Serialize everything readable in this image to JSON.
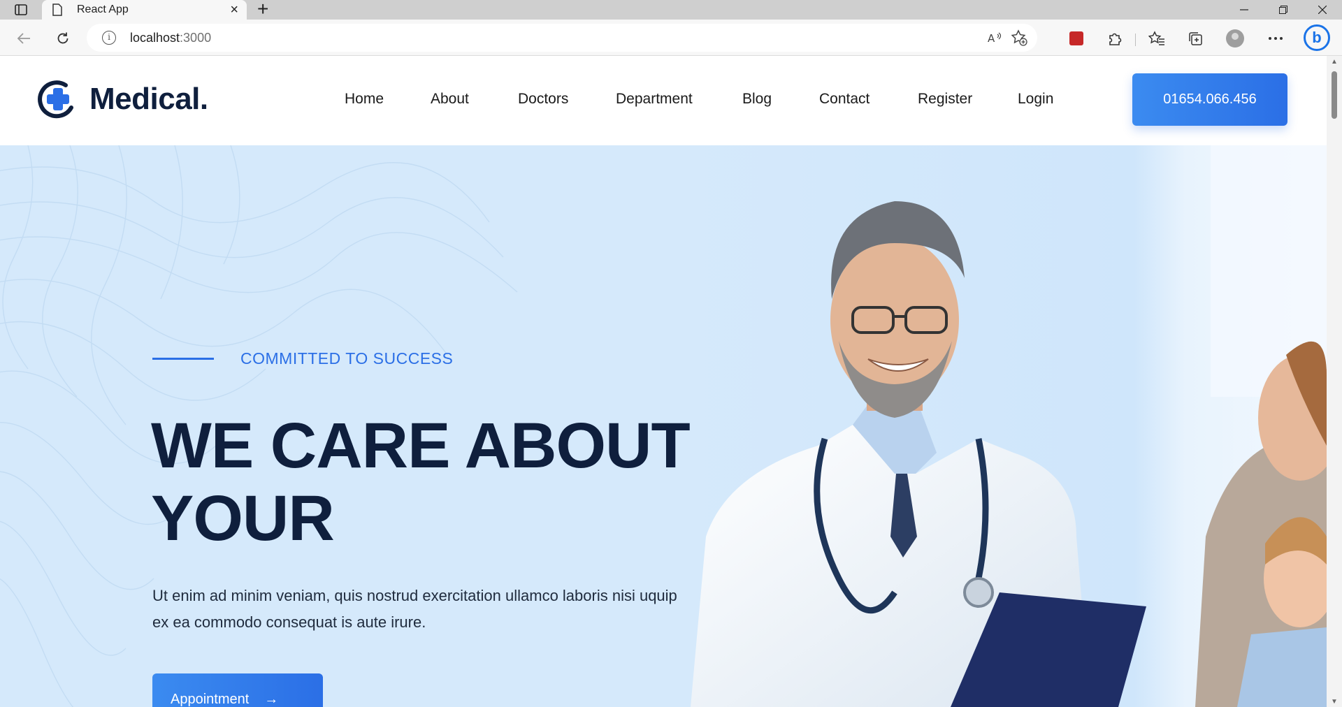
{
  "browser": {
    "tab_title": "React App",
    "new_tab_symbol": "+",
    "url_host": "localhost",
    "url_port": ":3000",
    "icons": [
      "sidebar-icon",
      "page-icon",
      "close-icon",
      "back-icon",
      "refresh-icon",
      "info-icon",
      "read-aloud-icon",
      "add-favorite-icon",
      "extension-icon",
      "puzzle-icon",
      "favorites-icon",
      "collections-icon",
      "profile-icon",
      "more-icon",
      "bing-icon"
    ]
  },
  "site": {
    "logo_text": "Medical.",
    "nav": [
      "Home",
      "About",
      "Doctors",
      "Department",
      "Blog",
      "Contact",
      "Register",
      "Login"
    ],
    "phone": "01654.066.456"
  },
  "hero": {
    "subtitle": "COMMITTED TO SUCCESS",
    "title_line1": "WE CARE ABOUT",
    "title_line2": "YOUR",
    "description": "Ut enim ad minim veniam, quis nostrud exercitation ullamco laboris nisi uquip ex ea commodo consequat is aute irure.",
    "button_label": "Appointment",
    "button_arrow": "→"
  },
  "colors": {
    "brand_blue": "#2b6fe6",
    "dark_navy": "#0f1f3d",
    "hero_bg": "#d5e9fb"
  }
}
